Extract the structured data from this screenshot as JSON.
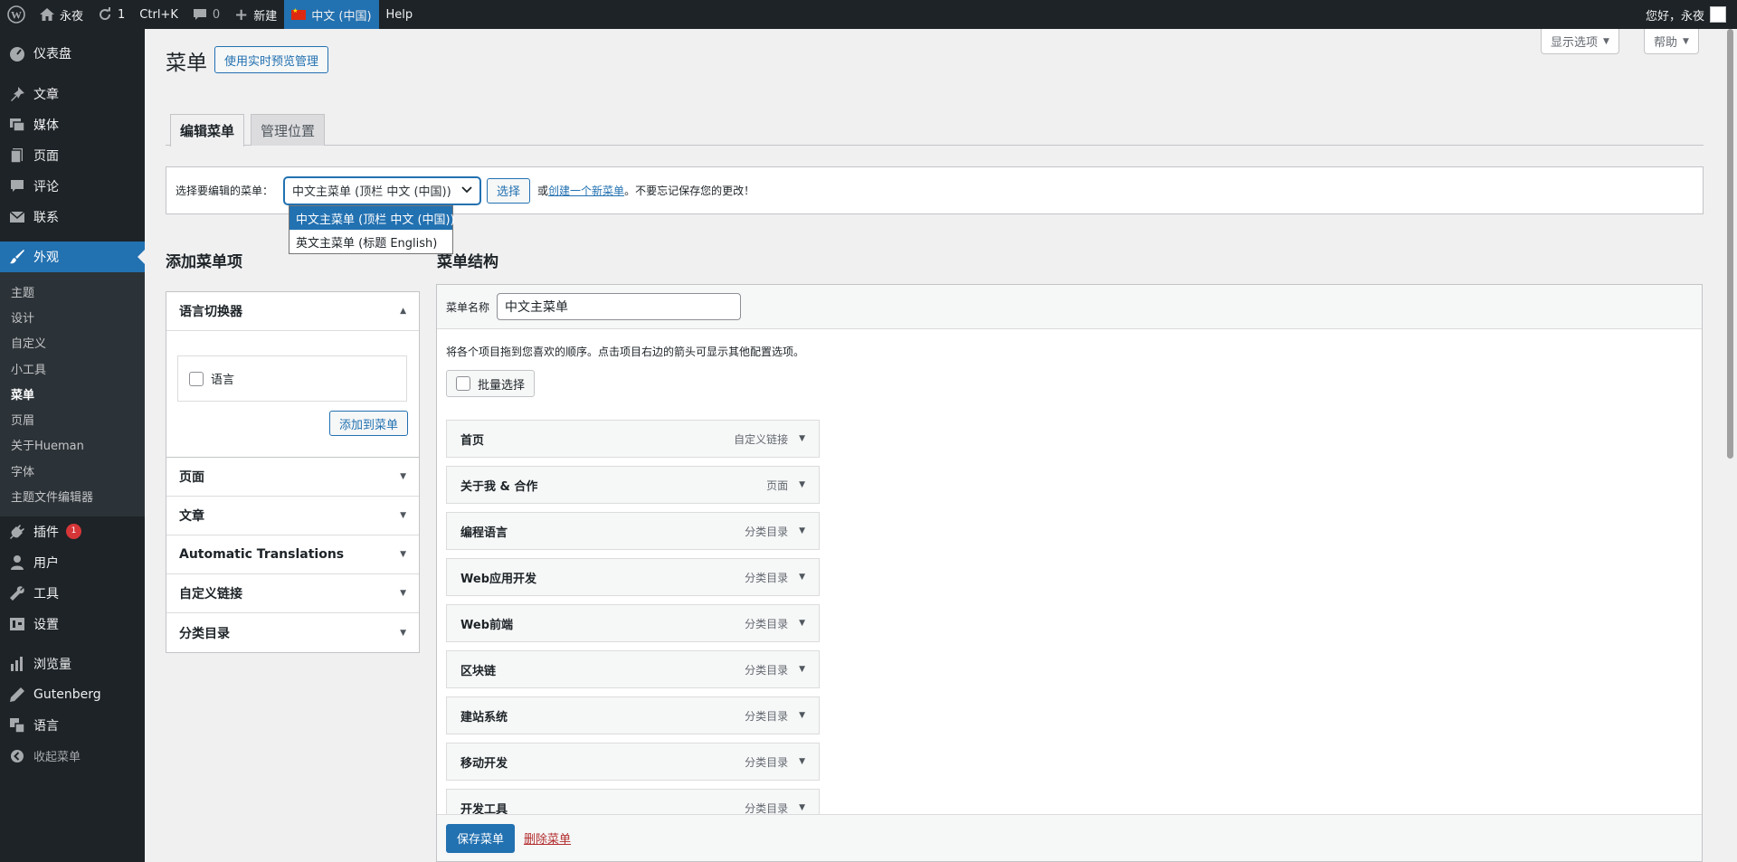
{
  "adminbar": {
    "site_name": "永夜",
    "updates_count": "1",
    "shortcut": "Ctrl+K",
    "comments_count": "0",
    "new_label": "新建",
    "language": "中文 (中国)",
    "help": "Help",
    "greeting": "您好，永夜"
  },
  "sidebar": {
    "items": [
      {
        "label": "仪表盘",
        "icon": "dashboard-icon"
      },
      {
        "label": "文章",
        "icon": "pin-icon"
      },
      {
        "label": "媒体",
        "icon": "media-icon"
      },
      {
        "label": "页面",
        "icon": "page-icon"
      },
      {
        "label": "评论",
        "icon": "comment-icon"
      },
      {
        "label": "联系",
        "icon": "mail-icon"
      },
      {
        "label": "外观",
        "icon": "brush-icon"
      }
    ],
    "submenu": [
      "主题",
      "设计",
      "自定义",
      "小工具",
      "菜单",
      "页眉",
      "关于Hueman",
      "字体",
      "主题文件编辑器"
    ],
    "items2": [
      {
        "label": "插件",
        "icon": "plugin-icon",
        "badge": "1"
      },
      {
        "label": "用户",
        "icon": "user-icon"
      },
      {
        "label": "工具",
        "icon": "wrench-icon"
      },
      {
        "label": "设置",
        "icon": "settings-icon"
      },
      {
        "label": "浏览量",
        "icon": "chart-icon"
      },
      {
        "label": "Gutenberg",
        "icon": "pen-icon"
      },
      {
        "label": "语言",
        "icon": "translate-icon"
      },
      {
        "label": "收起菜单",
        "icon": "collapse-icon"
      }
    ]
  },
  "page": {
    "title": "菜单",
    "live_preview": "使用实时预览管理",
    "screen_options": "显示选项",
    "help": "帮助"
  },
  "tabs": [
    "编辑菜单",
    "管理位置"
  ],
  "manage": {
    "label": "选择要编辑的菜单：",
    "selected": "中文主菜单 (顶栏 中文 (中国))",
    "options": [
      "中文主菜单 (顶栏 中文 (中国))",
      "英文主菜单 (标题 English)"
    ],
    "select_btn": "选择",
    "or": "或",
    "create_link": "创建一个新菜单",
    "reminder": "。不要忘记保存您的更改！"
  },
  "add_items": {
    "heading": "添加菜单项",
    "lang_switcher": "语言切换器",
    "lang_checkbox": "语言",
    "add_button": "添加到菜单",
    "sections": [
      "页面",
      "文章",
      "Automatic Translations",
      "自定义链接",
      "分类目录"
    ]
  },
  "structure": {
    "heading": "菜单结构",
    "name_label": "菜单名称",
    "name_value": "中文主菜单",
    "instructions": "将各个项目拖到您喜欢的顺序。点击项目右边的箭头可显示其他配置选项。",
    "bulk_select": "批量选择",
    "items": [
      {
        "title": "首页",
        "type": "自定义链接"
      },
      {
        "title": "关于我 & 合作",
        "type": "页面"
      },
      {
        "title": "编程语言",
        "type": "分类目录"
      },
      {
        "title": "Web应用开发",
        "type": "分类目录"
      },
      {
        "title": "Web前端",
        "type": "分类目录"
      },
      {
        "title": "区块链",
        "type": "分类目录"
      },
      {
        "title": "建站系统",
        "type": "分类目录"
      },
      {
        "title": "移动开发",
        "type": "分类目录"
      },
      {
        "title": "开发工具",
        "type": "分类目录"
      }
    ],
    "save": "保存菜单",
    "delete": "删除菜单"
  }
}
